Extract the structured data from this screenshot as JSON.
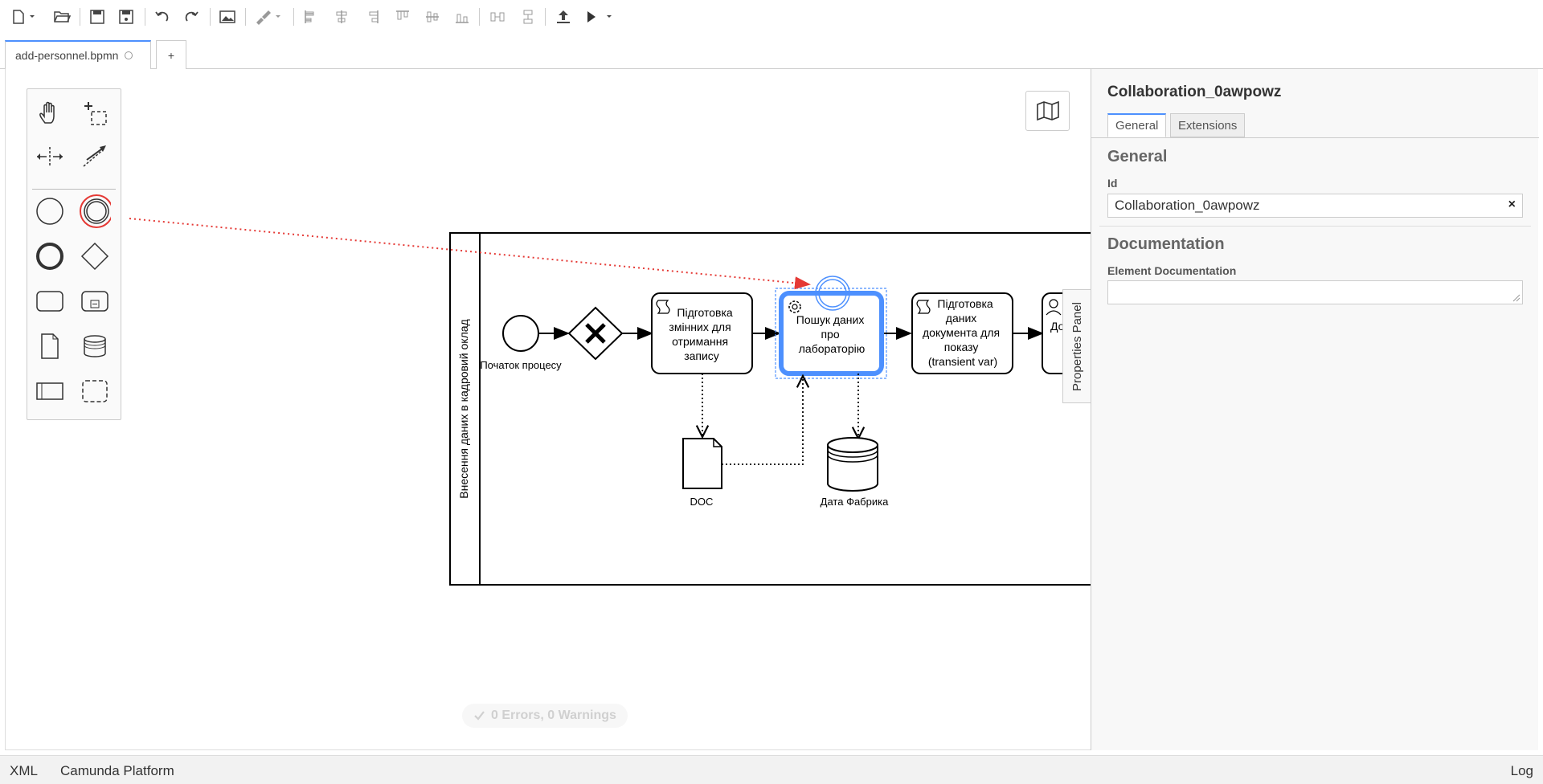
{
  "toolbar": {
    "buttons": [
      "new-file",
      "open-file",
      "save",
      "save-as",
      "undo",
      "redo",
      "export-image",
      "color-picker",
      "align-left",
      "align-center",
      "align-right",
      "align-top",
      "align-middle",
      "align-bottom",
      "distribute-horizontal",
      "distribute-vertical",
      "deploy",
      "start-instance"
    ]
  },
  "tabs": {
    "file_label": "add-personnel.bpmn",
    "add_label": "+"
  },
  "diagram": {
    "lane_label": "Внесення даних в кадровий оклад",
    "start_label": "Початок процесу",
    "task1_label": [
      "Підготовка",
      "змінних для",
      "отримання",
      "запису"
    ],
    "task2_label": [
      "Пошук даних",
      "про",
      "лабораторію"
    ],
    "task3_label": [
      "Підготовка",
      "даних",
      "документа для",
      "показу",
      "(transient var)"
    ],
    "task4_label": "До",
    "doc_label": "DOC",
    "store_label": "Дата Фабрика",
    "colors": {
      "selection": "#4d90fe",
      "arrow_hint": "#e53935"
    }
  },
  "status": {
    "text": "0 Errors, 0 Warnings"
  },
  "properties": {
    "toggle_label": "Properties Panel",
    "title": "Collaboration_0awpowz",
    "tabs": [
      "General",
      "Extensions"
    ],
    "general_title": "General",
    "id_label": "Id",
    "id_value": "Collaboration_0awpowz",
    "clear_label": "×",
    "documentation_title": "Documentation",
    "element_doc_label": "Element Documentation"
  },
  "footer": {
    "xml": "XML",
    "platform": "Camunda Platform",
    "log": "Log"
  }
}
